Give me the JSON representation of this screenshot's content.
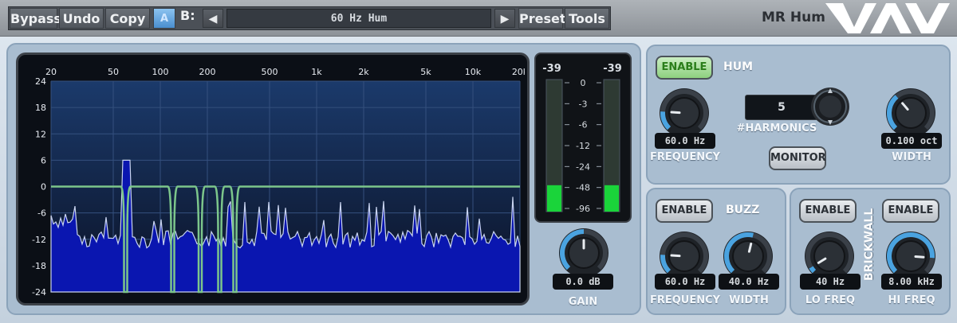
{
  "toolbar": {
    "bypass": "Bypass",
    "undo": "Undo",
    "copy": "Copy",
    "ab": "A",
    "b_label": "B:",
    "prev_icon": "triangle-left-icon",
    "next_icon": "triangle-right-icon",
    "preset_name": "60 Hz Hum",
    "preset": "Preset",
    "tools": "Tools"
  },
  "plugin_name": "MR Hum",
  "analyzer": {
    "x_ticks": [
      "20",
      "50",
      "100",
      "200",
      "500",
      "1k",
      "2k",
      "5k",
      "10k",
      "20k"
    ],
    "y_ticks": [
      "24",
      "18",
      "12",
      "6",
      "0",
      "-6",
      "-12",
      "-18",
      "-24"
    ]
  },
  "meter": {
    "left_peak": "-39",
    "right_peak": "-39",
    "scale": [
      "0",
      "-3",
      "-6",
      "-12",
      "-24",
      "-48",
      "-96"
    ],
    "left_level": 0.2,
    "right_level": 0.2
  },
  "gain": {
    "value": "0.0 dB",
    "label": "GAIN",
    "position": 0.5
  },
  "hum": {
    "title": "HUM",
    "enable": "ENABLE",
    "enabled": true,
    "harmonics_value": "5",
    "harmonics_label": "#HARMONICS",
    "monitor": "MONITOR",
    "frequency": {
      "value": "60.0 Hz",
      "label": "FREQUENCY",
      "position": 0.18
    },
    "width": {
      "value": "0.100 oct",
      "label": "WIDTH",
      "position": 0.35
    }
  },
  "buzz": {
    "title": "BUZZ",
    "enable": "ENABLE",
    "frequency": {
      "value": "60.0 Hz",
      "label": "FREQUENCY",
      "position": 0.18
    },
    "width": {
      "value": "40.0 Hz",
      "label": "WIDTH",
      "position": 0.55
    }
  },
  "brickwall": {
    "title": "BRICKWALL",
    "lo_enable": "ENABLE",
    "hi_enable": "ENABLE",
    "lo_freq": {
      "value": "40 Hz",
      "label": "LO FREQ",
      "position": 0.05
    },
    "hi_freq": {
      "value": "8.00 kHz",
      "label": "HI FREQ",
      "position": 0.85
    }
  },
  "colors": {
    "accent_blue": "#4aa3e0",
    "enable_green": "#2a7d1a",
    "meter_green": "#1ad43a",
    "spectrum_fill": "#0a16b0",
    "filter_curve": "#7cc68b"
  }
}
